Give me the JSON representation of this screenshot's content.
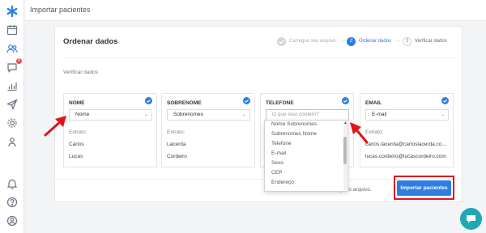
{
  "page": {
    "title": "Importar pacientes"
  },
  "sidebar": {
    "items": [
      {
        "icon": "asterisk-logo-icon"
      },
      {
        "icon": "calendar-icon"
      },
      {
        "icon": "users-icon"
      },
      {
        "icon": "chat-icon",
        "badge": "8"
      },
      {
        "icon": "chart-icon"
      },
      {
        "icon": "send-icon"
      },
      {
        "icon": "gear-icon"
      },
      {
        "icon": "person-icon"
      },
      {
        "icon": "bell-icon"
      },
      {
        "icon": "help-icon"
      },
      {
        "icon": "profile-icon"
      }
    ]
  },
  "card": {
    "title": "Ordenar dados",
    "steps": [
      {
        "number": "1",
        "label": "Carregue seu arquivo",
        "state": "done"
      },
      {
        "number": "2",
        "label": "Ordenar dados",
        "state": "active"
      },
      {
        "number": "3",
        "label": "Verificar dados",
        "state": "todo"
      }
    ],
    "section_label": "Verificar dados",
    "columns": [
      {
        "title": "NOME",
        "selected": "Nome",
        "extrato_label": "Extrato:",
        "values": [
          "Carlos",
          "Lucas"
        ]
      },
      {
        "title": "SOBRENOME",
        "selected": "Sobrenomes",
        "extrato_label": "Extrato:",
        "values": [
          "Lacerda",
          "Cordeiro"
        ]
      },
      {
        "title": "TELEFONE",
        "placeholder": "O que isso contém?",
        "extrato_label": "",
        "values": []
      },
      {
        "title": "EMAIL",
        "selected": "E-mail",
        "extrato_label": "Extrato:",
        "values": [
          "carlos.lacerda@carloslacerda.co...",
          "lucas.cordeiro@lucascordeiro.com"
        ]
      }
    ]
  },
  "dropdown": {
    "options": [
      "Nome Sobrenomes",
      "Sobrenomes Nome",
      "Telefone",
      "E-mail",
      "Sexo",
      "CEP",
      "Endereço"
    ]
  },
  "footer": {
    "hint": "ocê carregar o arquivo.",
    "cta_label": "Importar pacientes"
  },
  "colors": {
    "accent": "#2f7de1",
    "annotation": "#e0141b",
    "chat": "#1fa7b5"
  }
}
